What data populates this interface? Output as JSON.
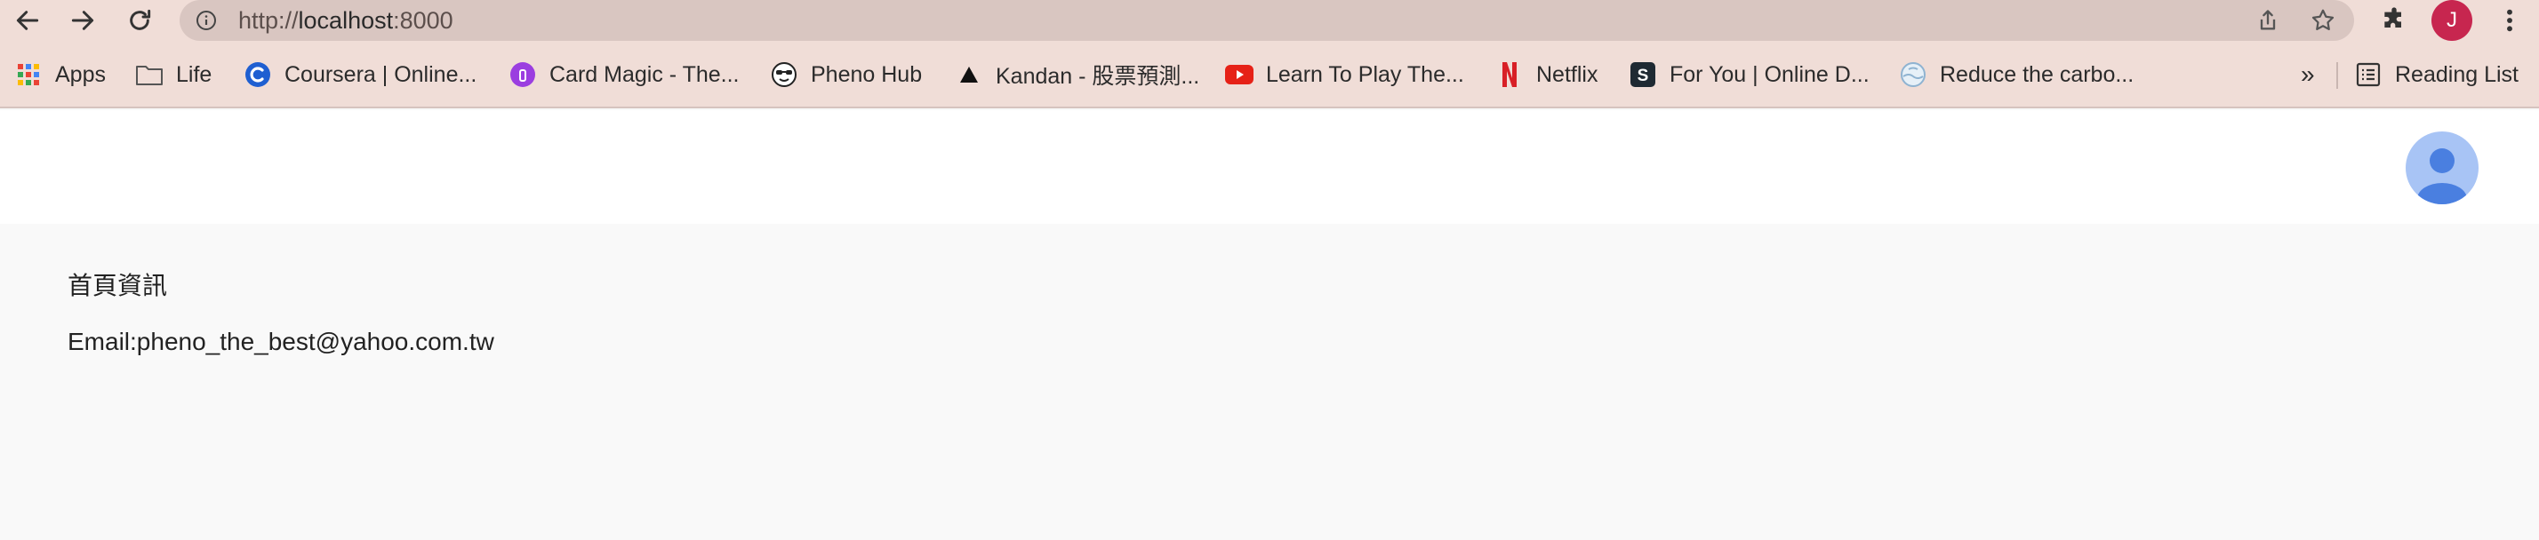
{
  "browser": {
    "url_prefix": "http://",
    "url_host": "localhost",
    "url_port": ":8000",
    "profile_initial": "J",
    "accent_color": "#c7264f"
  },
  "bookmarks": [
    {
      "label": "Apps",
      "icon": "apps-grid-icon"
    },
    {
      "label": "Life",
      "icon": "folder-icon"
    },
    {
      "label": "Coursera | Online...",
      "icon": "coursera-icon"
    },
    {
      "label": "Card Magic - The...",
      "icon": "card-magic-icon"
    },
    {
      "label": "Pheno Hub",
      "icon": "sunglasses-face-icon"
    },
    {
      "label": "Kandan - 股票預測...",
      "icon": "triangle-icon"
    },
    {
      "label": "Learn To Play The...",
      "icon": "youtube-icon"
    },
    {
      "label": "Netflix",
      "icon": "netflix-icon"
    },
    {
      "label": "For You | Online D...",
      "icon": "s-logo-icon"
    },
    {
      "label": "Reduce the carbo...",
      "icon": "globe-icon"
    }
  ],
  "bookmarks_overflow": "»",
  "reading_list": "Reading List",
  "page": {
    "title": "首頁資訊",
    "email_line": "Email:pheno_the_best@yahoo.com.tw"
  }
}
